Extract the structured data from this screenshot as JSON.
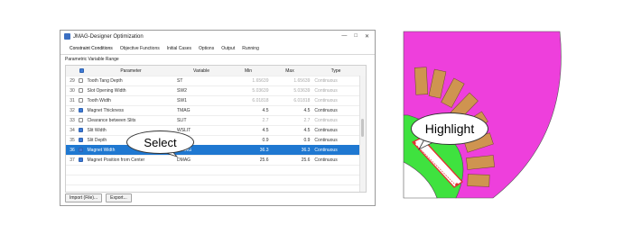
{
  "window": {
    "title": "JMAG-Designer Optimization",
    "controls": [
      "—",
      "□",
      "✕"
    ]
  },
  "tabs": [
    {
      "label": "Constraint Conditions",
      "active": true
    },
    {
      "label": "Objective Functions",
      "active": false
    },
    {
      "label": "Initial Cases",
      "active": false
    },
    {
      "label": "Options",
      "active": false
    },
    {
      "label": "Output",
      "active": false
    },
    {
      "label": "Running",
      "active": false
    }
  ],
  "section_title": "Parametric Variable Range",
  "table": {
    "headers": [
      "",
      "Parameter",
      "Variable",
      "Min",
      "Max",
      "Type"
    ],
    "rows": [
      {
        "num": "29",
        "checked": false,
        "param": "Tooth Tang Depth",
        "var": "ST",
        "min": "1.65639",
        "max": "1.65639",
        "type": "Continuous",
        "disabled": true
      },
      {
        "num": "30",
        "checked": false,
        "param": "Slot Opening Width",
        "var": "SW2",
        "min": "5.03639",
        "max": "5.03639",
        "type": "Continuous",
        "disabled": true
      },
      {
        "num": "31",
        "checked": false,
        "param": "Tooth Width",
        "var": "SW1",
        "min": "6.01818",
        "max": "6.01818",
        "type": "Continuous",
        "disabled": true
      },
      {
        "num": "32",
        "checked": true,
        "param": "Magnet Thickness",
        "var": "TMAG",
        "min": "4.5",
        "max": "4.5",
        "type": "Continuous",
        "disabled": false
      },
      {
        "num": "33",
        "checked": false,
        "param": "Clearance between Slits",
        "var": "SLIT",
        "min": "2.7",
        "max": "2.7",
        "type": "Continuous",
        "disabled": true
      },
      {
        "num": "34",
        "checked": true,
        "param": "Slit Width",
        "var": "WSLIT",
        "min": "4.5",
        "max": "4.5",
        "type": "Continuous",
        "disabled": false
      },
      {
        "num": "35",
        "checked": true,
        "param": "Slit Depth",
        "var": "DSLIT",
        "min": "0.9",
        "max": "0.9",
        "type": "Continuous",
        "disabled": false
      },
      {
        "num": "36",
        "checked": true,
        "param": "Magnet Width",
        "var": "WMAG",
        "min": "36.3",
        "max": "36.3",
        "type": "Continuous",
        "disabled": false,
        "selected": true
      },
      {
        "num": "37",
        "checked": true,
        "param": "Magnet Position from Center",
        "var": "DMAG",
        "min": "25.6",
        "max": "25.6",
        "type": "Continuous",
        "disabled": false
      },
      {
        "num": "",
        "checked": false,
        "param": "",
        "var": "",
        "min": "",
        "max": "",
        "type": "",
        "disabled": false
      },
      {
        "num": "",
        "checked": false,
        "param": "",
        "var": "",
        "min": "",
        "max": "",
        "type": "",
        "disabled": false
      }
    ]
  },
  "buttons": {
    "import": "Import (File)...",
    "export": "Export..."
  },
  "callouts": {
    "select": "Select",
    "highlight": "Highlight"
  },
  "colors": {
    "stator": "#ee3fdc",
    "rotor": "#3fe23f",
    "coil": "#cf9450",
    "selection": "#1f78d1",
    "highlight": "#e03030"
  }
}
